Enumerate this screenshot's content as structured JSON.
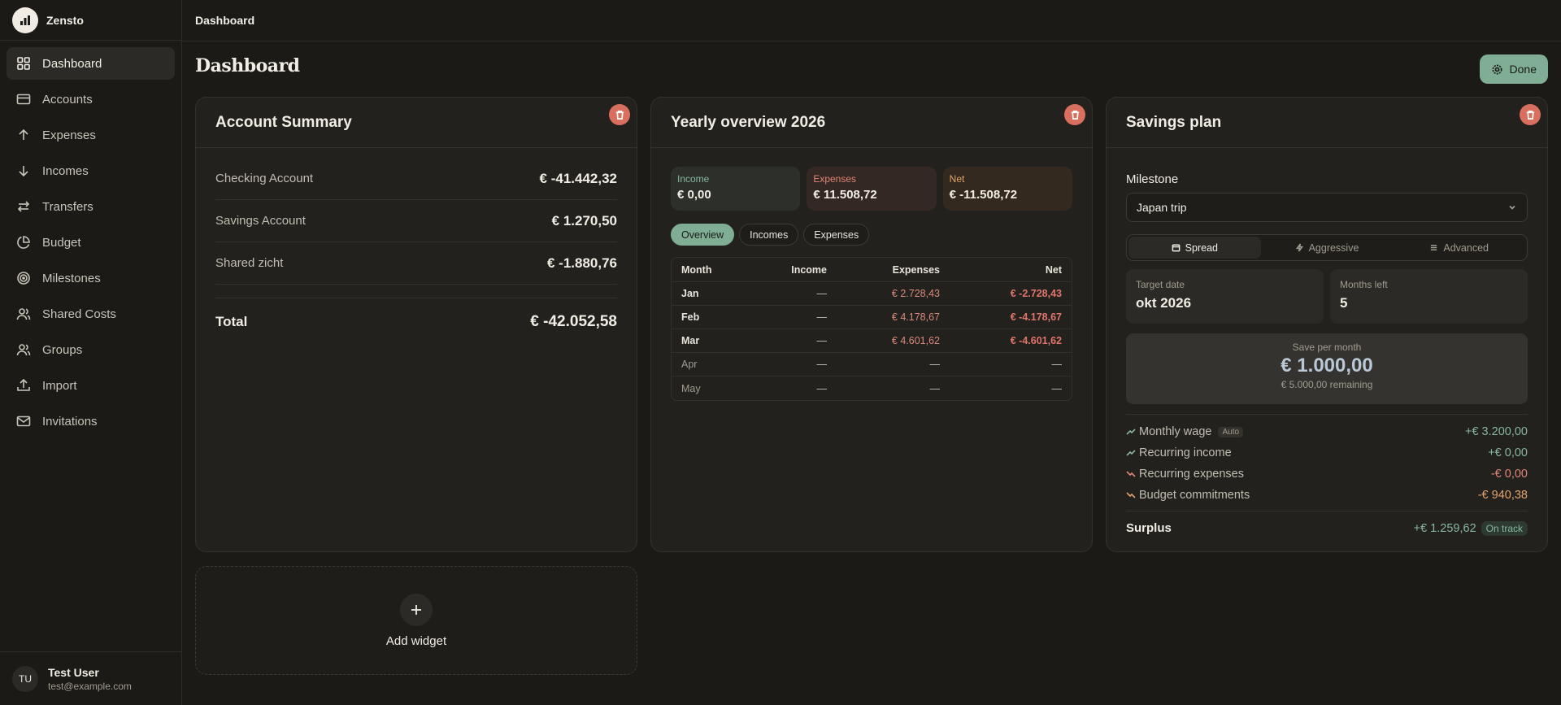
{
  "app": {
    "name": "Zensto"
  },
  "sidebar": {
    "items": [
      {
        "label": "Dashboard",
        "icon": "dashboard-grid-icon"
      },
      {
        "label": "Accounts",
        "icon": "credit-card-icon"
      },
      {
        "label": "Expenses",
        "icon": "arrow-up-icon"
      },
      {
        "label": "Incomes",
        "icon": "arrow-down-icon"
      },
      {
        "label": "Transfers",
        "icon": "transfer-arrows-icon"
      },
      {
        "label": "Budget",
        "icon": "pie-chart-icon"
      },
      {
        "label": "Milestones",
        "icon": "target-icon"
      },
      {
        "label": "Shared Costs",
        "icon": "users-icon"
      },
      {
        "label": "Groups",
        "icon": "group-icon"
      },
      {
        "label": "Import",
        "icon": "upload-icon"
      },
      {
        "label": "Invitations",
        "icon": "mail-icon"
      }
    ],
    "user": {
      "initials": "TU",
      "name": "Test User",
      "email": "test@example.com"
    }
  },
  "topbar": {
    "title": "Dashboard"
  },
  "page": {
    "title": "Dashboard",
    "done_label": "Done"
  },
  "account_summary": {
    "title": "Account Summary",
    "accounts": [
      {
        "name": "Checking Account",
        "value": "€ -41.442,32"
      },
      {
        "name": "Savings Account",
        "value": "€ 1.270,50"
      },
      {
        "name": "Shared zicht",
        "value": "€ -1.880,76"
      }
    ],
    "total_label": "Total",
    "total_value": "€ -42.052,58"
  },
  "yearly": {
    "title": "Yearly overview 2026",
    "income_label": "Income",
    "income_value": "€ 0,00",
    "expenses_label": "Expenses",
    "expenses_value": "€ 11.508,72",
    "net_label": "Net",
    "net_value": "€ -11.508,72",
    "tabs": [
      "Overview",
      "Incomes",
      "Expenses"
    ],
    "columns": [
      "Month",
      "Income",
      "Expenses",
      "Net"
    ],
    "rows": [
      {
        "month": "Jan",
        "income": "—",
        "expenses": "€ 2.728,43",
        "net": "€ -2.728,43"
      },
      {
        "month": "Feb",
        "income": "—",
        "expenses": "€ 4.178,67",
        "net": "€ -4.178,67"
      },
      {
        "month": "Mar",
        "income": "—",
        "expenses": "€ 4.601,62",
        "net": "€ -4.601,62"
      },
      {
        "month": "Apr",
        "income": "—",
        "expenses": "—",
        "net": "—"
      },
      {
        "month": "May",
        "income": "—",
        "expenses": "—",
        "net": "—"
      }
    ]
  },
  "savings": {
    "title": "Savings plan",
    "milestone_label": "Milestone",
    "milestone_value": "Japan trip",
    "modes": [
      "Spread",
      "Aggressive",
      "Advanced"
    ],
    "target_date_label": "Target date",
    "target_date_value": "okt 2026",
    "months_left_label": "Months left",
    "months_left_value": "5",
    "save_label": "Save per month",
    "save_value": "€ 1.000,00",
    "remaining": "€ 5.000,00 remaining",
    "flows": [
      {
        "label": "Monthly wage",
        "badge": "Auto",
        "value": "+€ 3.200,00"
      },
      {
        "label": "Recurring income",
        "value": "+€ 0,00"
      },
      {
        "label": "Recurring expenses",
        "value": "-€ 0,00"
      },
      {
        "label": "Budget commitments",
        "value": "-€ 940,38"
      }
    ],
    "surplus_label": "Surplus",
    "surplus_value": "+€ 1.259,62",
    "status": "On track"
  },
  "add_widget": {
    "label": "Add widget"
  },
  "colors": {
    "accent": "#7fae95",
    "danger": "#d9705f",
    "background": "#1b1a17",
    "card": "#23211e"
  }
}
